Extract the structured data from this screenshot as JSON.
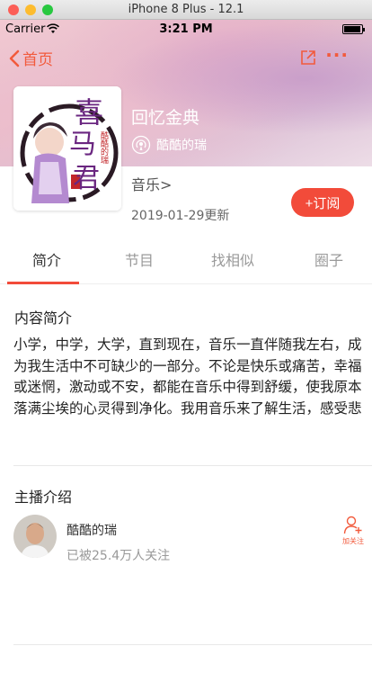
{
  "simulator": {
    "title": "iPhone 8 Plus - 12.1"
  },
  "status_bar": {
    "carrier": "Carrier",
    "time": "3:21 PM"
  },
  "nav": {
    "back_label": "首页"
  },
  "album": {
    "title": "回忆金典",
    "anchor": "酷酷的瑞",
    "category": "音乐>",
    "updated": "2019-01-29更新",
    "subscribe_label": "+订阅",
    "cover_text": {
      "main": "喜马君",
      "side": "酷酷的瑞"
    }
  },
  "tabs": [
    {
      "label": "简介"
    },
    {
      "label": "节目"
    },
    {
      "label": "找相似"
    },
    {
      "label": "圈子"
    }
  ],
  "intro": {
    "heading": "内容简介",
    "text": "小学，中学，大学，直到现在，音乐一直伴随我左右，成为我生活中不可缺少的一部分。不论是快乐或痛苦，幸福或迷惘，激动或不安，都能在音乐中得到舒缓，使我原本落满尘埃的心灵得到净化。我用音乐来了解生活，感受悲"
  },
  "host": {
    "heading": "主播介绍",
    "name": "酷酷的瑞",
    "followers": "已被25.4万人关注",
    "follow_label": "加关注"
  },
  "colors": {
    "accent": "#f24b3a"
  }
}
